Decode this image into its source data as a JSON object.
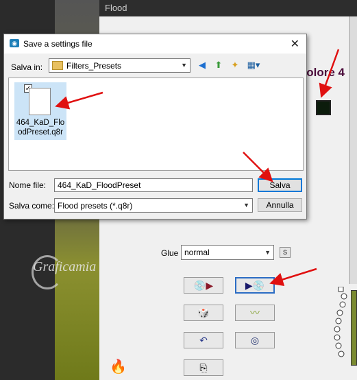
{
  "flood": {
    "title": "Flood",
    "colore_label": "Colore 4",
    "colore_swatch": "#0c1c0c",
    "glue_label": "Glue",
    "glue_value": "normal",
    "small_btn": "S"
  },
  "watermark": "Graficamia",
  "dialog": {
    "title": "Save a settings file",
    "save_in_label": "Salva in:",
    "save_in_value": "Filters_Presets",
    "file": {
      "name_line1": "464_KaD_Flo",
      "name_line2": "odPreset.q8r"
    },
    "filename_label": "Nome file:",
    "filename_value": "464_KaD_FloodPreset",
    "savetype_label": "Salva come:",
    "savetype_value": "Flood presets (*.q8r)",
    "save_button": "Salva",
    "cancel_button": "Annulla"
  },
  "colors": {
    "accent": "#0078d7",
    "arrow": "#e01010"
  }
}
